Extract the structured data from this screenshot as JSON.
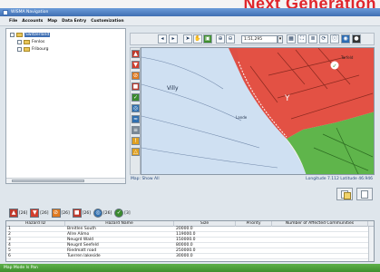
{
  "banner": "Next Generation",
  "window": {
    "title": "WISMA Navigation"
  },
  "menu": [
    "File",
    "Accounts",
    "Map",
    "Data Entry",
    "Customization"
  ],
  "tree": [
    {
      "label": "Switzerland",
      "expanded": true
    },
    {
      "label": "Fenlos",
      "expanded": false
    },
    {
      "label": "Fribourg",
      "expanded": false
    }
  ],
  "map_toolbar": {
    "scale": "1:51,295"
  },
  "map": {
    "labels": [
      "Villy",
      "Tarfeld",
      "Lande"
    ],
    "status_left": "Map: Show All",
    "status_right": "Longitude 7.112 Latitude 46.946"
  },
  "hazard_tabs": [
    {
      "icon": "fire-icon",
      "color": "#c0392b",
      "count": "[26]"
    },
    {
      "icon": "flood-icon",
      "color": "#d23e2e",
      "count": "[26]"
    },
    {
      "icon": "no-entry-icon",
      "color": "#e07a1f",
      "count": "[26]"
    },
    {
      "icon": "hospital-icon",
      "color": "#c0392b",
      "count": "[26]"
    },
    {
      "icon": "recycle-icon",
      "color": "#2f6fb0",
      "count": "[26]"
    },
    {
      "icon": "checkmark-icon",
      "color": "#3a8a2e",
      "count": "[3]"
    }
  ],
  "table": {
    "columns": [
      "Hazard ID",
      "Hazard Name",
      "Size",
      "Priority",
      "Number of Affected Communities"
    ],
    "rows": [
      [
        "1",
        "Breitlen South",
        "20000.0",
        "",
        ""
      ],
      [
        "2",
        "Allre Alimo",
        "119000.0",
        "",
        ""
      ],
      [
        "3",
        "Neugrd Wald",
        "150000.0",
        "",
        ""
      ],
      [
        "4",
        "Neugrd Seefeld",
        "80000.0",
        "",
        ""
      ],
      [
        "5",
        "Riedmatt road",
        "250000.0",
        "",
        ""
      ],
      [
        "6",
        "Tuerren lakeside",
        "30000.0",
        "",
        ""
      ]
    ]
  },
  "status": "Map Mode Is Pan",
  "colors": {
    "accent": "#3f6fb3",
    "hazard_area": "#e03a2c",
    "green_zone": "#4fae3a",
    "water": "#cfe0f2"
  }
}
